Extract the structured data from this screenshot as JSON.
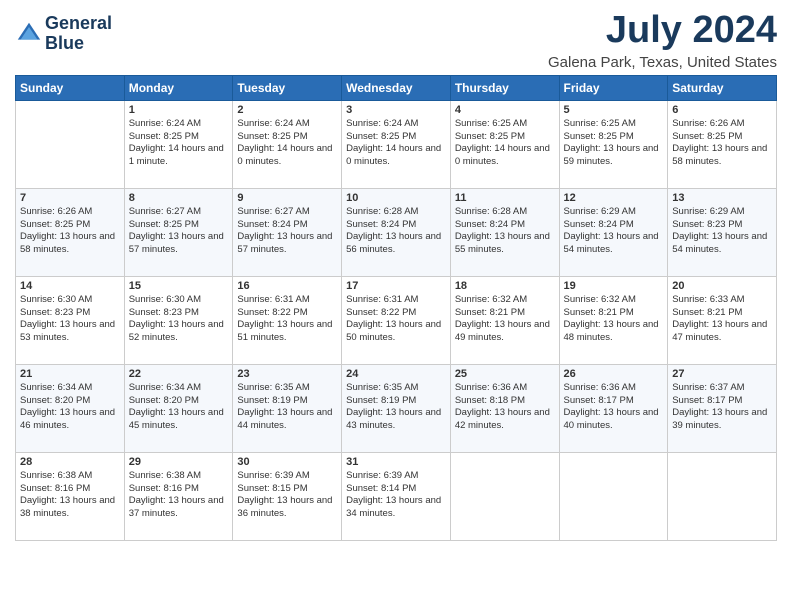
{
  "header": {
    "logo_line1": "General",
    "logo_line2": "Blue",
    "month": "July 2024",
    "location": "Galena Park, Texas, United States"
  },
  "days_of_week": [
    "Sunday",
    "Monday",
    "Tuesday",
    "Wednesday",
    "Thursday",
    "Friday",
    "Saturday"
  ],
  "weeks": [
    [
      {
        "day": "",
        "sunrise": "",
        "sunset": "",
        "daylight": ""
      },
      {
        "day": "1",
        "sunrise": "Sunrise: 6:24 AM",
        "sunset": "Sunset: 8:25 PM",
        "daylight": "Daylight: 14 hours and 1 minute."
      },
      {
        "day": "2",
        "sunrise": "Sunrise: 6:24 AM",
        "sunset": "Sunset: 8:25 PM",
        "daylight": "Daylight: 14 hours and 0 minutes."
      },
      {
        "day": "3",
        "sunrise": "Sunrise: 6:24 AM",
        "sunset": "Sunset: 8:25 PM",
        "daylight": "Daylight: 14 hours and 0 minutes."
      },
      {
        "day": "4",
        "sunrise": "Sunrise: 6:25 AM",
        "sunset": "Sunset: 8:25 PM",
        "daylight": "Daylight: 14 hours and 0 minutes."
      },
      {
        "day": "5",
        "sunrise": "Sunrise: 6:25 AM",
        "sunset": "Sunset: 8:25 PM",
        "daylight": "Daylight: 13 hours and 59 minutes."
      },
      {
        "day": "6",
        "sunrise": "Sunrise: 6:26 AM",
        "sunset": "Sunset: 8:25 PM",
        "daylight": "Daylight: 13 hours and 58 minutes."
      }
    ],
    [
      {
        "day": "7",
        "sunrise": "Sunrise: 6:26 AM",
        "sunset": "Sunset: 8:25 PM",
        "daylight": "Daylight: 13 hours and 58 minutes."
      },
      {
        "day": "8",
        "sunrise": "Sunrise: 6:27 AM",
        "sunset": "Sunset: 8:25 PM",
        "daylight": "Daylight: 13 hours and 57 minutes."
      },
      {
        "day": "9",
        "sunrise": "Sunrise: 6:27 AM",
        "sunset": "Sunset: 8:24 PM",
        "daylight": "Daylight: 13 hours and 57 minutes."
      },
      {
        "day": "10",
        "sunrise": "Sunrise: 6:28 AM",
        "sunset": "Sunset: 8:24 PM",
        "daylight": "Daylight: 13 hours and 56 minutes."
      },
      {
        "day": "11",
        "sunrise": "Sunrise: 6:28 AM",
        "sunset": "Sunset: 8:24 PM",
        "daylight": "Daylight: 13 hours and 55 minutes."
      },
      {
        "day": "12",
        "sunrise": "Sunrise: 6:29 AM",
        "sunset": "Sunset: 8:24 PM",
        "daylight": "Daylight: 13 hours and 54 minutes."
      },
      {
        "day": "13",
        "sunrise": "Sunrise: 6:29 AM",
        "sunset": "Sunset: 8:23 PM",
        "daylight": "Daylight: 13 hours and 54 minutes."
      }
    ],
    [
      {
        "day": "14",
        "sunrise": "Sunrise: 6:30 AM",
        "sunset": "Sunset: 8:23 PM",
        "daylight": "Daylight: 13 hours and 53 minutes."
      },
      {
        "day": "15",
        "sunrise": "Sunrise: 6:30 AM",
        "sunset": "Sunset: 8:23 PM",
        "daylight": "Daylight: 13 hours and 52 minutes."
      },
      {
        "day": "16",
        "sunrise": "Sunrise: 6:31 AM",
        "sunset": "Sunset: 8:22 PM",
        "daylight": "Daylight: 13 hours and 51 minutes."
      },
      {
        "day": "17",
        "sunrise": "Sunrise: 6:31 AM",
        "sunset": "Sunset: 8:22 PM",
        "daylight": "Daylight: 13 hours and 50 minutes."
      },
      {
        "day": "18",
        "sunrise": "Sunrise: 6:32 AM",
        "sunset": "Sunset: 8:21 PM",
        "daylight": "Daylight: 13 hours and 49 minutes."
      },
      {
        "day": "19",
        "sunrise": "Sunrise: 6:32 AM",
        "sunset": "Sunset: 8:21 PM",
        "daylight": "Daylight: 13 hours and 48 minutes."
      },
      {
        "day": "20",
        "sunrise": "Sunrise: 6:33 AM",
        "sunset": "Sunset: 8:21 PM",
        "daylight": "Daylight: 13 hours and 47 minutes."
      }
    ],
    [
      {
        "day": "21",
        "sunrise": "Sunrise: 6:34 AM",
        "sunset": "Sunset: 8:20 PM",
        "daylight": "Daylight: 13 hours and 46 minutes."
      },
      {
        "day": "22",
        "sunrise": "Sunrise: 6:34 AM",
        "sunset": "Sunset: 8:20 PM",
        "daylight": "Daylight: 13 hours and 45 minutes."
      },
      {
        "day": "23",
        "sunrise": "Sunrise: 6:35 AM",
        "sunset": "Sunset: 8:19 PM",
        "daylight": "Daylight: 13 hours and 44 minutes."
      },
      {
        "day": "24",
        "sunrise": "Sunrise: 6:35 AM",
        "sunset": "Sunset: 8:19 PM",
        "daylight": "Daylight: 13 hours and 43 minutes."
      },
      {
        "day": "25",
        "sunrise": "Sunrise: 6:36 AM",
        "sunset": "Sunset: 8:18 PM",
        "daylight": "Daylight: 13 hours and 42 minutes."
      },
      {
        "day": "26",
        "sunrise": "Sunrise: 6:36 AM",
        "sunset": "Sunset: 8:17 PM",
        "daylight": "Daylight: 13 hours and 40 minutes."
      },
      {
        "day": "27",
        "sunrise": "Sunrise: 6:37 AM",
        "sunset": "Sunset: 8:17 PM",
        "daylight": "Daylight: 13 hours and 39 minutes."
      }
    ],
    [
      {
        "day": "28",
        "sunrise": "Sunrise: 6:38 AM",
        "sunset": "Sunset: 8:16 PM",
        "daylight": "Daylight: 13 hours and 38 minutes."
      },
      {
        "day": "29",
        "sunrise": "Sunrise: 6:38 AM",
        "sunset": "Sunset: 8:16 PM",
        "daylight": "Daylight: 13 hours and 37 minutes."
      },
      {
        "day": "30",
        "sunrise": "Sunrise: 6:39 AM",
        "sunset": "Sunset: 8:15 PM",
        "daylight": "Daylight: 13 hours and 36 minutes."
      },
      {
        "day": "31",
        "sunrise": "Sunrise: 6:39 AM",
        "sunset": "Sunset: 8:14 PM",
        "daylight": "Daylight: 13 hours and 34 minutes."
      },
      {
        "day": "",
        "sunrise": "",
        "sunset": "",
        "daylight": ""
      },
      {
        "day": "",
        "sunrise": "",
        "sunset": "",
        "daylight": ""
      },
      {
        "day": "",
        "sunrise": "",
        "sunset": "",
        "daylight": ""
      }
    ]
  ]
}
